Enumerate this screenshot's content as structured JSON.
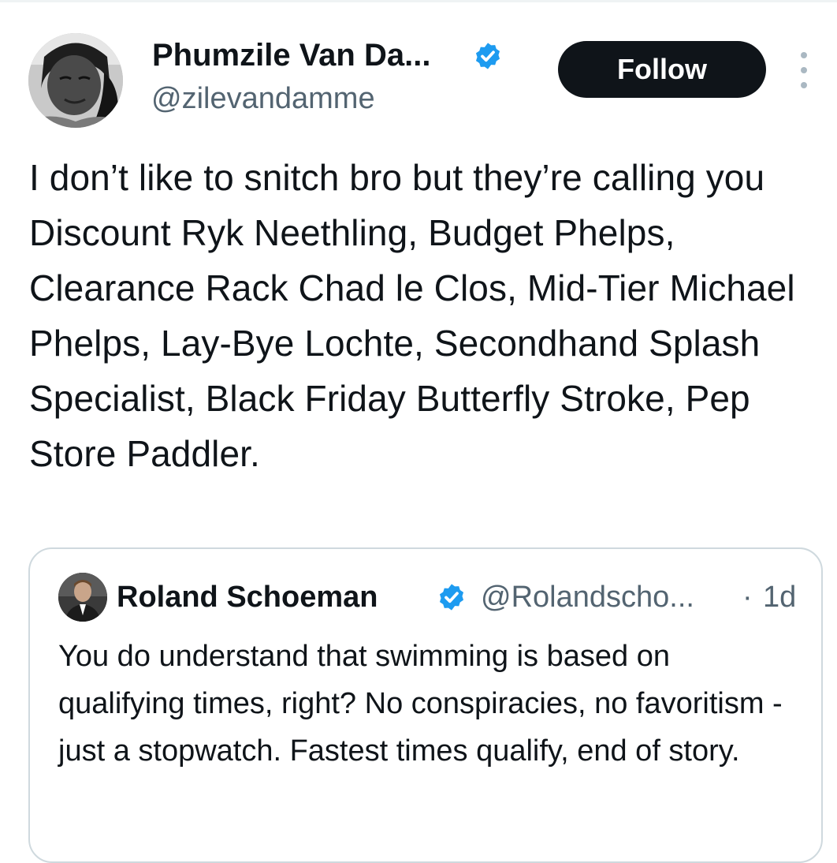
{
  "tweet": {
    "author_name": "Phumzile Van Da...",
    "author_handle": "@zilevandamme",
    "follow_label": "Follow",
    "text": "I don’t like to snitch bro but they’re calling you Discount Ryk Neethling, Budget Phelps, Clearance Rack Chad le Clos, Mid-Tier Michael Phelps, Lay-Bye Lochte, Secondhand Splash Specialist, Black Friday Butterfly Stroke, Pep Store Paddler."
  },
  "quote": {
    "author_name": "Roland Schoeman",
    "author_handle": "@Rolandscho...",
    "separator": "·",
    "time": "1d",
    "text": "You do understand that swimming is based on qualifying times, right? No conspiracies, no favoritism - just a stopwatch. Fastest times qualify, end of story."
  },
  "icons": {
    "verified_badge": "verified-badge-icon",
    "more": "more-vertical-icon"
  },
  "colors": {
    "verified_blue": "#1d9bf0",
    "follow_button_bg": "#0f1419",
    "secondary_text": "#536471",
    "card_border": "#cfd9de"
  }
}
